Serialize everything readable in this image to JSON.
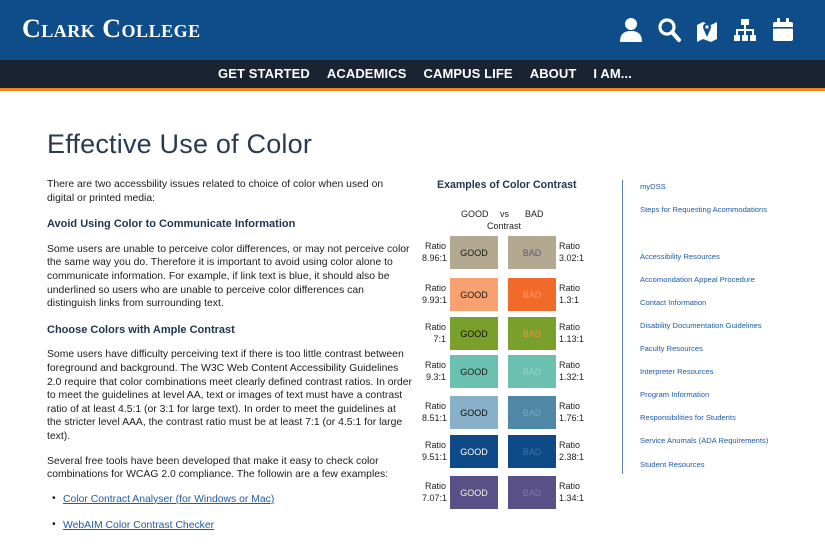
{
  "header": {
    "logo_text": "Clark College",
    "icons": [
      "user-icon",
      "search-icon",
      "map-icon",
      "sitemap-icon",
      "calendar-icon"
    ],
    "brand_color": "#0f4c8a",
    "nav_bg_color": "#1a2332",
    "accent_color": "#f5821f"
  },
  "nav": {
    "items": [
      "GET STARTED",
      "ACADEMICS",
      "CAMPUS LIFE",
      "ABOUT",
      "I AM..."
    ]
  },
  "main": {
    "title": "Effective Use of Color",
    "intro": "There are two accessbility issues related to choice of color when used on digital or printed media:",
    "sections": [
      {
        "heading": "Avoid Using Color to Communicate Information",
        "paragraphs": [
          "Some users are unable to perceive color differences, or may not perceive color the same way you do. Therefore it is important to avoid using color alone to communicate information. For example, if link text is blue, it should also be underlined so users who are unable to perceive color differences can distinguish links from surrounding text."
        ]
      },
      {
        "heading": "Choose Colors with Ample Contrast",
        "paragraphs": [
          "Some users have difficulty perceiving text if there is too little contrast between foreground and background. The W3C Web Content Accessibility Guidelines 2.0 require that color combinations meet clearly defined contrast ratios. In order to meet the guidelines at level AA, text or images of text must have a contrast ratio of at least 4.5:1 (or 3:1 for large text). In order to meet the guidelines at the stricter level AAA, the contrast ratio must be at least 7:1 (or 4.5:1 for large text).",
          "Several free tools have been developed that make it easy to check color combinations for WCAG 2.0 compliance. The followin are a few examples:"
        ]
      }
    ],
    "tools": [
      "Color Contract Analyser (for Windows or Mac)",
      "WebAIM Color Contrast Checker"
    ]
  },
  "contrast_examples": {
    "title": "Examples of Color Contrast",
    "col_good": "GOOD",
    "col_vs": "vs",
    "col_bad": "BAD",
    "col_contrast": "Contrast",
    "ratio_word": "Ratio",
    "rows": [
      {
        "good_ratio": "8.96:1",
        "bad_ratio": "3.02:1",
        "good_label": "GOOD",
        "bad_label": "BAD",
        "good_bg": "#b3a890",
        "good_fg": "#1a1a1a",
        "bad_bg": "#b3a890",
        "bad_fg": "#5b5b7a"
      },
      {
        "good_ratio": "9.93:1",
        "bad_ratio": "1.3:1",
        "good_label": "GOOD",
        "bad_label": "BAD",
        "good_bg": "#f7a070",
        "good_fg": "#1a1a1a",
        "bad_bg": "#f26a2a",
        "bad_fg": "#f79a6a"
      },
      {
        "good_ratio": "7:1",
        "bad_ratio": "1.13:1",
        "good_label": "GOOD",
        "bad_label": "BAD",
        "good_bg": "#78a02a",
        "good_fg": "#111111",
        "bad_bg": "#78a02a",
        "bad_fg": "#f09050"
      },
      {
        "good_ratio": "9.3:1",
        "bad_ratio": "1.32:1",
        "good_label": "GOOD",
        "bad_label": "BAD",
        "good_bg": "#6cc0b0",
        "good_fg": "#1a1a1a",
        "bad_bg": "#6cc0b0",
        "bad_fg": "#9ad4c4"
      },
      {
        "good_ratio": "8.51:1",
        "bad_ratio": "1.76:1",
        "good_label": "GOOD",
        "bad_label": "BAD",
        "good_bg": "#88b0c8",
        "good_fg": "#111111",
        "bad_bg": "#4f88a6",
        "bad_fg": "#7aa8c4"
      },
      {
        "good_ratio": "9.51:1",
        "bad_ratio": "2.38:1",
        "good_label": "GOOD",
        "bad_label": "BAD",
        "good_bg": "#0f4a88",
        "good_fg": "#ffffff",
        "bad_bg": "#0f4a88",
        "bad_fg": "#3c70a8"
      },
      {
        "good_ratio": "7.07:1",
        "bad_ratio": "1.34:1",
        "good_label": "GOOD",
        "bad_label": "BAD",
        "good_bg": "#5a5088",
        "good_fg": "#f4f0e0",
        "bad_bg": "#5a5088",
        "bad_fg": "#8078a8"
      }
    ]
  },
  "sidebar": {
    "links": [
      "myDSS",
      "Steps for Requesting Acommodations",
      "Accessibility Resources",
      "Accomondation Appeal Procedure",
      "Contact Information",
      "Disability Documentation Guidelines",
      "Faculty Resources",
      "Interpreter Resources",
      "Program Information",
      "Responsibilities for Students",
      "Service Anumals (ADA Requirements)",
      "Student Resources"
    ]
  }
}
